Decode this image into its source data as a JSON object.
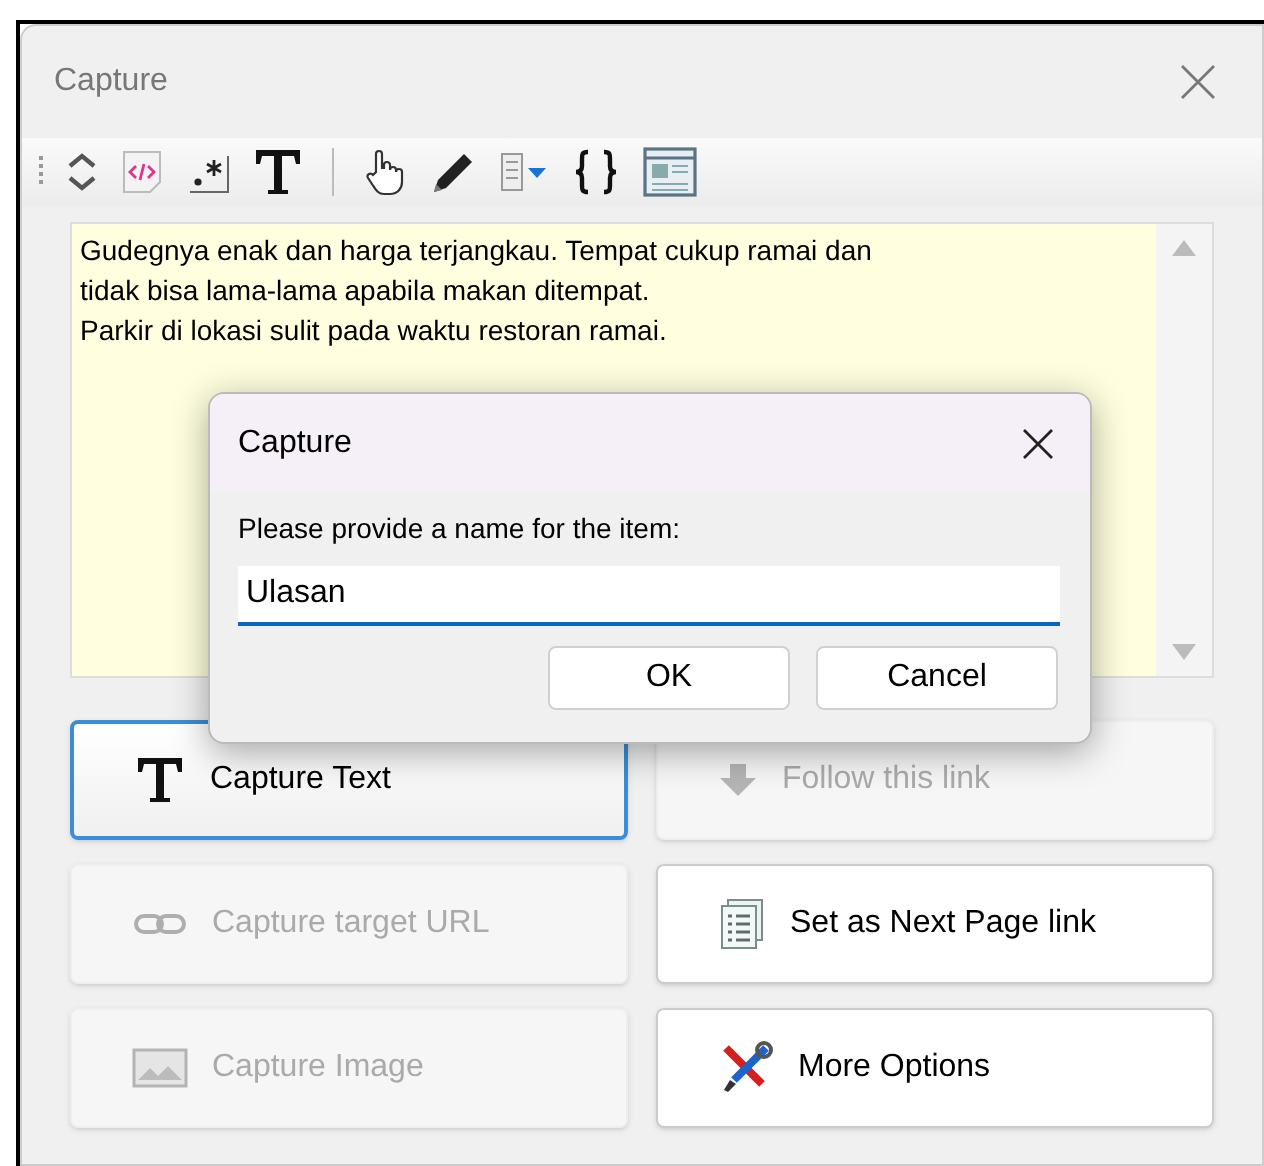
{
  "window": {
    "title": "Capture"
  },
  "toolbar": [
    {
      "kind": "updown"
    },
    {
      "kind": "html"
    },
    {
      "kind": "regex"
    },
    {
      "kind": "text"
    },
    {
      "kind": "separator"
    },
    {
      "kind": "hand"
    },
    {
      "kind": "pencil"
    },
    {
      "kind": "dropdown"
    },
    {
      "kind": "braces"
    },
    {
      "kind": "page"
    }
  ],
  "text_area": {
    "lines": [
      "Gudegnya enak dan harga terjangkau. Tempat cukup ramai dan",
      "tidak bisa lama-lama apabila makan ditempat.",
      "Parkir di lokasi sulit pada waktu restoran ramai."
    ]
  },
  "actions": [
    {
      "label": "Capture Text",
      "kind": "text",
      "disabled": false,
      "focused": true
    },
    {
      "label": "Follow this link",
      "kind": "arrow",
      "disabled": true,
      "focused": false
    },
    {
      "label": "Capture target URL",
      "kind": "link",
      "disabled": true,
      "focused": false
    },
    {
      "label": "Set as Next Page link",
      "kind": "list",
      "disabled": false,
      "focused": false
    },
    {
      "label": "Capture Image",
      "kind": "image",
      "disabled": true,
      "focused": false
    },
    {
      "label": "More Options",
      "kind": "tools",
      "disabled": false,
      "focused": false
    }
  ],
  "dialog": {
    "title": "Capture",
    "prompt": "Please provide a name for the item:",
    "value": "Ulasan",
    "buttons": [
      "OK",
      "Cancel"
    ]
  }
}
